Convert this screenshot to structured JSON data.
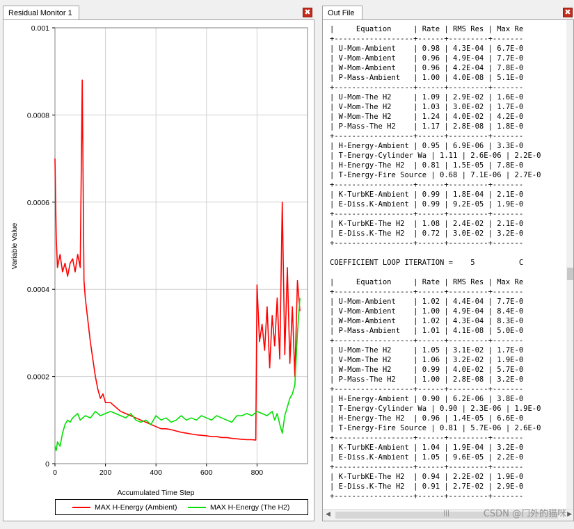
{
  "residual_tab": {
    "title": "Residual Monitor 1",
    "close_glyph": "✖"
  },
  "out_tab": {
    "title": "Out File",
    "close_glyph": "✖"
  },
  "legend": [
    {
      "label": "MAX H-Energy (Ambient)",
      "color": "#ff0000"
    },
    {
      "label": "MAX H-Energy (The H2)",
      "color": "#00e000"
    }
  ],
  "chart_data": {
    "type": "line",
    "title": "",
    "xlabel": "Accumulated Time Step",
    "ylabel": "Variable Value",
    "xlim": [
      0,
      1000
    ],
    "ylim": [
      0,
      0.001
    ],
    "x_ticks": [
      "0",
      "200",
      "400",
      "600",
      "800"
    ],
    "y_ticks": [
      "0",
      "0.0002",
      "0.0004",
      "0.0006",
      "0.0008",
      "0.001"
    ],
    "x_tick_values": [
      0,
      200,
      400,
      600,
      800
    ],
    "y_tick_values": [
      0,
      0.0002,
      0.0004,
      0.0006,
      0.0008,
      0.001
    ],
    "grid": true,
    "legend_position": "bottom",
    "series": [
      {
        "name": "MAX H-Energy (Ambient)",
        "color": "#ff0000",
        "x": [
          0,
          5,
          10,
          20,
          30,
          40,
          50,
          60,
          70,
          80,
          90,
          100,
          108,
          115,
          120,
          130,
          140,
          150,
          160,
          170,
          180,
          190,
          200,
          220,
          240,
          260,
          280,
          300,
          320,
          340,
          360,
          380,
          400,
          420,
          440,
          460,
          480,
          500,
          520,
          540,
          560,
          580,
          600,
          620,
          640,
          660,
          680,
          700,
          720,
          740,
          760,
          780,
          795,
          800,
          810,
          820,
          830,
          840,
          850,
          860,
          870,
          880,
          890,
          900,
          910,
          920,
          930,
          940,
          950,
          960,
          970
        ],
        "y": [
          0.0007,
          0.00052,
          0.00045,
          0.00048,
          0.00044,
          0.00046,
          0.00043,
          0.00046,
          0.00047,
          0.00044,
          0.00048,
          0.00045,
          0.00088,
          0.00042,
          0.00038,
          0.00033,
          0.00028,
          0.00024,
          0.0002,
          0.00017,
          0.00015,
          0.00016,
          0.00014,
          0.00014,
          0.00013,
          0.00012,
          0.000115,
          0.00011,
          0.000105,
          0.0001,
          9.5e-05,
          9e-05,
          8.5e-05,
          8e-05,
          8e-05,
          7.8e-05,
          7.5e-05,
          7.2e-05,
          7e-05,
          6.8e-05,
          6.6e-05,
          6.5e-05,
          6.4e-05,
          6.2e-05,
          6.2e-05,
          6e-05,
          6e-05,
          5.8e-05,
          5.7e-05,
          5.6e-05,
          5.5e-05,
          5.5e-05,
          5.4e-05,
          0.00041,
          0.00028,
          0.00032,
          0.00026,
          0.00036,
          0.00022,
          0.00034,
          0.00027,
          0.00038,
          0.00024,
          0.0006,
          0.00025,
          0.00045,
          0.00023,
          0.00036,
          0.0002,
          0.00042,
          0.00035
        ]
      },
      {
        "name": "MAX H-Energy (The H2)",
        "color": "#00e000",
        "x": [
          0,
          5,
          10,
          20,
          30,
          40,
          50,
          60,
          70,
          80,
          90,
          100,
          120,
          140,
          160,
          180,
          200,
          220,
          240,
          260,
          280,
          300,
          320,
          340,
          360,
          380,
          400,
          420,
          440,
          460,
          480,
          500,
          520,
          540,
          560,
          580,
          600,
          620,
          640,
          660,
          680,
          700,
          720,
          740,
          760,
          780,
          800,
          820,
          840,
          860,
          870,
          880,
          890,
          900,
          910,
          920,
          930,
          940,
          950,
          960,
          970
        ],
        "y": [
          4e-05,
          3e-05,
          5e-05,
          4e-05,
          7e-05,
          9e-05,
          0.0001,
          9.5e-05,
          0.000105,
          0.00011,
          0.000115,
          0.0001,
          0.00011,
          0.000105,
          0.00012,
          0.00011,
          0.000115,
          0.00012,
          0.000115,
          0.00011,
          0.000105,
          0.000115,
          0.0001,
          9.5e-05,
          0.0001,
          9e-05,
          0.00011,
          0.0001,
          0.000105,
          9.5e-05,
          0.0001,
          0.00011,
          0.0001,
          0.000105,
          0.0001,
          0.00011,
          0.000105,
          0.0001,
          0.00011,
          0.000105,
          0.0001,
          9.5e-05,
          0.00011,
          0.00011,
          0.000115,
          0.00011,
          0.00012,
          0.000115,
          0.00011,
          0.00012,
          0.0001,
          0.000115,
          9e-05,
          7e-05,
          0.00011,
          0.00013,
          0.00015,
          0.00016,
          0.00018,
          0.0003,
          0.00038
        ]
      }
    ]
  },
  "out_lines": [
    "|     Equation     | Rate | RMS Res | Max Re",
    "+------------------+------+---------+-------",
    "| U-Mom-Ambient    | 0.98 | 4.3E-04 | 6.7E-0",
    "| V-Mom-Ambient    | 0.96 | 4.9E-04 | 7.7E-0",
    "| W-Mom-Ambient    | 0.96 | 4.2E-04 | 7.8E-0",
    "| P-Mass-Ambient   | 1.00 | 4.0E-08 | 5.1E-0",
    "+------------------+------+---------+-------",
    "| U-Mom-The H2     | 1.09 | 2.9E-02 | 1.6E-0",
    "| V-Mom-The H2     | 1.03 | 3.0E-02 | 1.7E-0",
    "| W-Mom-The H2     | 1.24 | 4.0E-02 | 4.2E-0",
    "| P-Mass-The H2    | 1.17 | 2.8E-08 | 1.8E-0",
    "+------------------+------+---------+-------",
    "| H-Energy-Ambient | 0.95 | 6.9E-06 | 3.3E-0",
    "| T-Energy-Cylinder Wa | 1.11 | 2.6E-06 | 2.2E-0",
    "| H-Energy-The H2  | 0.81 | 1.5E-05 | 7.8E-0",
    "| T-Energy-Fire Source | 0.68 | 7.1E-06 | 2.7E-0",
    "+------------------+------+---------+-------",
    "| K-TurbKE-Ambient | 0.99 | 1.8E-04 | 2.1E-0",
    "| E-Diss.K-Ambient | 0.99 | 9.2E-05 | 1.9E-0",
    "+------------------+------+---------+-------",
    "| K-TurbKE-The H2  | 1.08 | 2.4E-02 | 2.1E-0",
    "| E-Diss.K-The H2  | 0.72 | 3.0E-02 | 3.2E-0",
    "+------------------+------+---------+-------",
    "",
    "COEFFICIENT LOOP ITERATION =    5          C",
    "",
    "|     Equation     | Rate | RMS Res | Max Re",
    "+------------------+------+---------+-------",
    "| U-Mom-Ambient    | 1.02 | 4.4E-04 | 7.7E-0",
    "| V-Mom-Ambient    | 1.00 | 4.9E-04 | 8.4E-0",
    "| W-Mom-Ambient    | 1.02 | 4.3E-04 | 8.3E-0",
    "| P-Mass-Ambient   | 1.01 | 4.1E-08 | 5.0E-0",
    "+------------------+------+---------+-------",
    "| U-Mom-The H2     | 1.05 | 3.1E-02 | 1.7E-0",
    "| V-Mom-The H2     | 1.06 | 3.2E-02 | 1.9E-0",
    "| W-Mom-The H2     | 0.99 | 4.0E-02 | 5.7E-0",
    "| P-Mass-The H2    | 1.00 | 2.8E-08 | 3.2E-0",
    "+------------------+------+---------+-------",
    "| H-Energy-Ambient | 0.90 | 6.2E-06 | 3.8E-0",
    "| T-Energy-Cylinder Wa | 0.90 | 2.3E-06 | 1.9E-0",
    "| H-Energy-The H2  | 0.96 | 1.4E-05 | 6.6E-0",
    "| T-Energy-Fire Source | 0.81 | 5.7E-06 | 2.6E-0",
    "+------------------+------+---------+-------",
    "| K-TurbKE-Ambient | 1.04 | 1.9E-04 | 3.2E-0",
    "| E-Diss.K-Ambient | 1.05 | 9.6E-05 | 2.2E-0",
    "+------------------+------+---------+-------",
    "| K-TurbKE-The H2  | 0.94 | 2.2E-02 | 1.9E-0",
    "| E-Diss.K-The H2  | 0.91 | 2.7E-02 | 2.9E-0",
    "+------------------+------+---------+-------"
  ],
  "watermark": "CSDN @门外的猫咪"
}
